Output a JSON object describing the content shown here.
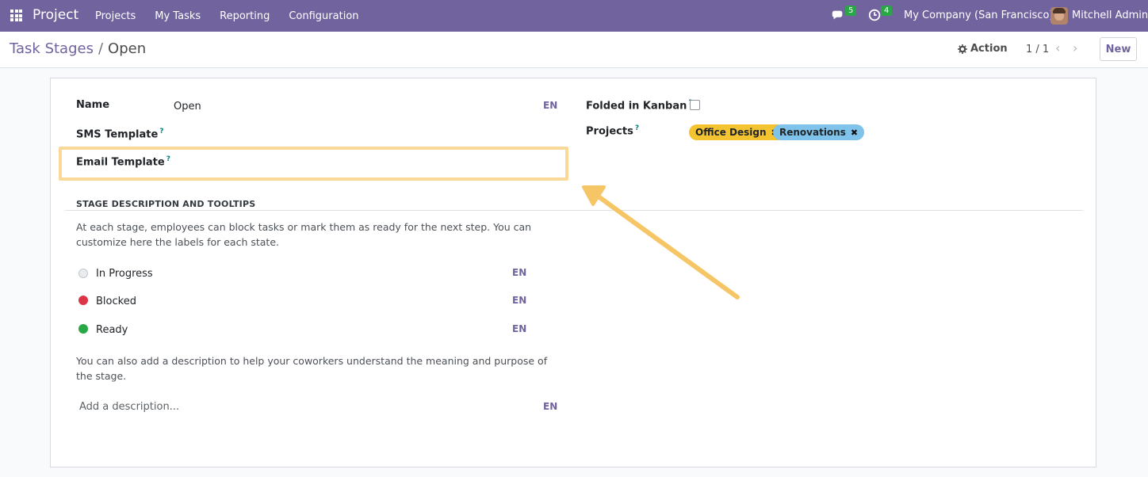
{
  "navbar": {
    "app_name": "Project",
    "menu": [
      "Projects",
      "My Tasks",
      "Reporting",
      "Configuration"
    ],
    "messages_count": "5",
    "activities_count": "4",
    "company": "My Company (San Francisco)",
    "user": "Mitchell Admin"
  },
  "control_panel": {
    "breadcrumb_parent": "Task Stages",
    "breadcrumb_separator": "/",
    "breadcrumb_current": "Open",
    "action_label": "Action",
    "pager": "1 / 1",
    "new_label": "New"
  },
  "form": {
    "name_label": "Name",
    "name_value": "Open",
    "lang": "EN",
    "sms_template_label": "SMS Template",
    "email_template_label": "Email Template",
    "help_mark": "?",
    "folded_label": "Folded in Kanban",
    "folded_checked": false,
    "projects_label": "Projects",
    "projects": [
      {
        "name": "Office Design",
        "color": "#f4c430"
      },
      {
        "name": "Renovations",
        "color": "#7fc3ea"
      }
    ],
    "section_title": "STAGE DESCRIPTION AND TOOLTIPS",
    "intro_text": "At each stage, employees can block tasks or mark them as ready for the next step. You can customize here the labels for each state.",
    "states": [
      {
        "label": "In Progress",
        "color": "#e9ecef"
      },
      {
        "label": "Blocked",
        "color": "#dc3545"
      },
      {
        "label": "Ready",
        "color": "#28a745"
      }
    ],
    "description_help": "You can also add a description to help your coworkers understand the meaning and purpose of the stage.",
    "description_placeholder": "Add a description..."
  }
}
